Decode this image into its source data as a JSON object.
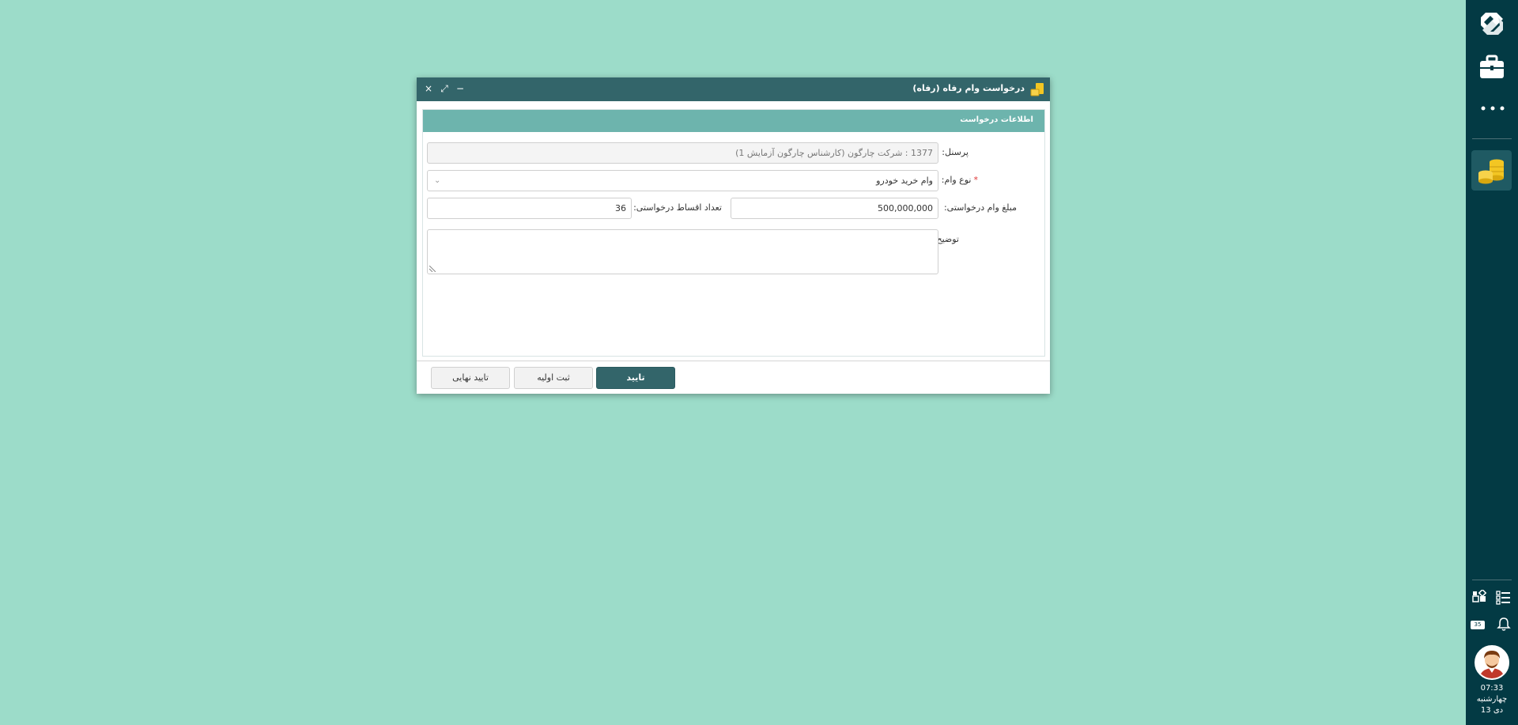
{
  "dialog": {
    "title": "درخواست وام رفاه (رفاه)",
    "section_title": "اطلاعات درخواست",
    "fields": {
      "personnel_label": "پرسنل:",
      "personnel_value": "1377 : شرکت چارگون (کارشناس چارگون آزمایش 1)",
      "loan_type_label": "نوع وام:",
      "loan_type_required": "*",
      "loan_type_value": "وام خرید خودرو",
      "amount_label": "مبلغ وام درخواستی:",
      "amount_value": "500,000,000",
      "installments_label": "تعداد اقساط درخواستی:",
      "installments_value": "36",
      "description_label": "توضیح:"
    },
    "buttons": {
      "confirm": "تایید",
      "initial_save": "ثبت اولیه",
      "final_confirm": "تایید نهایی"
    },
    "window_controls": {
      "minimize": "−",
      "maximize": "⤢",
      "close": "×"
    }
  },
  "sidebar": {
    "notification_count": "35",
    "time": "07:33",
    "weekday": "چهارشنبه",
    "date": "13 دی"
  },
  "colors": {
    "background": "#9cdcc9",
    "sidebar": "#033a44",
    "titlebar": "#33656a",
    "section_header": "#6db4ad",
    "primary_button": "#33656a"
  },
  "icons": [
    "app-logo-icon",
    "briefcase-icon",
    "more-icon",
    "loan-coins-icon",
    "dashboard-icon",
    "list-icon",
    "message-icon",
    "bell-icon"
  ]
}
